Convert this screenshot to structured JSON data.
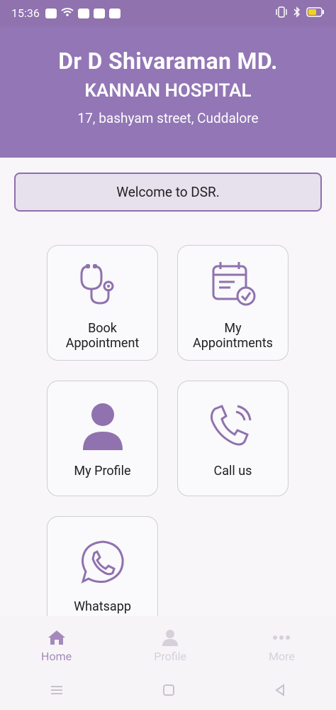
{
  "status_bar": {
    "time": "15:36"
  },
  "header": {
    "doctor": "Dr D Shivaraman MD.",
    "hospital": "KANNAN HOSPITAL",
    "address": "17, bashyam street, Cuddalore"
  },
  "welcome": "Welcome to DSR.",
  "tiles": [
    {
      "label": "Book\nAppointment",
      "icon": "stethoscope-icon"
    },
    {
      "label": "My\nAppointments",
      "icon": "calendar-check-icon"
    },
    {
      "label": "My Profile",
      "icon": "user-icon"
    },
    {
      "label": "Call us",
      "icon": "phone-icon"
    },
    {
      "label": "Whatsapp",
      "icon": "whatsapp-icon"
    }
  ],
  "bottom_nav": [
    {
      "label": "Home",
      "icon": "home-icon",
      "active": true
    },
    {
      "label": "Profile",
      "icon": "person-icon",
      "active": false
    },
    {
      "label": "More",
      "icon": "more-dots-icon",
      "active": false
    }
  ],
  "colors": {
    "brand": "#9276b5",
    "welcome_bg": "#e7e1ee",
    "icon_purple": "#8f72ae"
  }
}
